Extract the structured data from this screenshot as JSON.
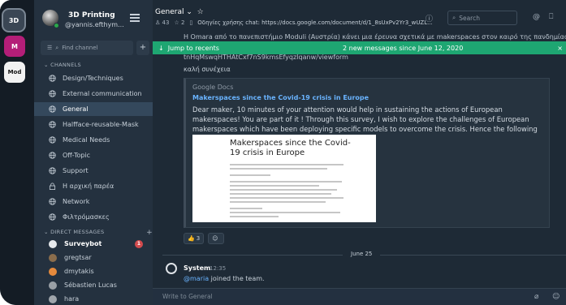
{
  "teams": [
    "3D",
    "M",
    "Mod"
  ],
  "sidebar": {
    "team_name": "3D Printing",
    "username": "@yannis.efthym...",
    "find_channel": "Find channel",
    "add": "+",
    "channels_header": "CHANNELS",
    "channels": [
      {
        "label": "Design/Techniques",
        "icon": "globe-icon"
      },
      {
        "label": "External communication",
        "icon": "globe-icon"
      },
      {
        "label": "General",
        "icon": "globe-icon",
        "active": true
      },
      {
        "label": "Halfface-reusable-Mask",
        "icon": "globe-icon"
      },
      {
        "label": "Medical Needs",
        "icon": "globe-icon"
      },
      {
        "label": "Off-Topic",
        "icon": "globe-icon"
      },
      {
        "label": "Support",
        "icon": "globe-icon"
      },
      {
        "label": "Η αρχική παρέα",
        "icon": "lock-icon"
      },
      {
        "label": "Network",
        "icon": "globe-icon"
      },
      {
        "label": "Φιλτρόμασκες",
        "icon": "globe-icon"
      }
    ],
    "dm_header": "DIRECT MESSAGES",
    "dm_add": "+",
    "dms": [
      {
        "label": "Surveybot",
        "badge": "1",
        "color": "#e6e9ec"
      },
      {
        "label": "gregtsar",
        "color": "#8a6d4c"
      },
      {
        "label": "dmytakis",
        "color": "#e58a3c"
      },
      {
        "label": "Sébastien Lucas",
        "color": "#9aa0a6"
      },
      {
        "label": "hara",
        "color": "#a0a6ac"
      }
    ]
  },
  "header": {
    "channel_name": "General ⌄",
    "star": "☆",
    "members": "43",
    "pinned": "2",
    "header_text": "Οδηγίες χρήσης chat: https://docs.google.com/document/d/1_8sUxPv2Yr3_wUZL...",
    "search_placeholder": "Search"
  },
  "messages": {
    "top_text": "Η Omara από το πανεπιστήμιο Moduli (Αυστρία) κάνει μια έρευνα σχετικά με makerspaces στον καιρό της πανδημίας, αν έχει",
    "link_fragment": "tnHqMswqHTHAtCxf7nS9kmsEfyqzIqanw/viewform",
    "greeting": "καλή συνέχεια",
    "preview": {
      "site": "Google Docs",
      "title": "Makerspaces since the Covid-19 crisis in Europe",
      "description": "Dear maker, 10 minutes of your attention would help in sustaining the actions of European makerspaces! You are part of it ! Through this survey, I wish to explore the challenges of European makerspaces which have been deploying specific models to overcome the crisis. Hence the following issue...",
      "more": "▾",
      "doc_title": "Makerspaces since the Covid-19 crisis in Europe"
    },
    "reactions": [
      {
        "emoji": "👍",
        "count": "3"
      },
      {
        "emoji": "☺",
        "count": ""
      }
    ],
    "date_separator": "June 25",
    "system": {
      "author": "System",
      "time": "12:35",
      "mention": "@maria",
      "text": " joined the team."
    }
  },
  "banner": {
    "jump": "Jump to recents",
    "new_messages": "2 new messages since June 12, 2020",
    "close": "×"
  },
  "composer": {
    "placeholder": "Write to General"
  },
  "colors": {
    "accent": "#1ea672",
    "link": "#6ab4ff",
    "sidebar": "#24313f",
    "main": "#1e2a36",
    "badge": "#d24b4e"
  }
}
